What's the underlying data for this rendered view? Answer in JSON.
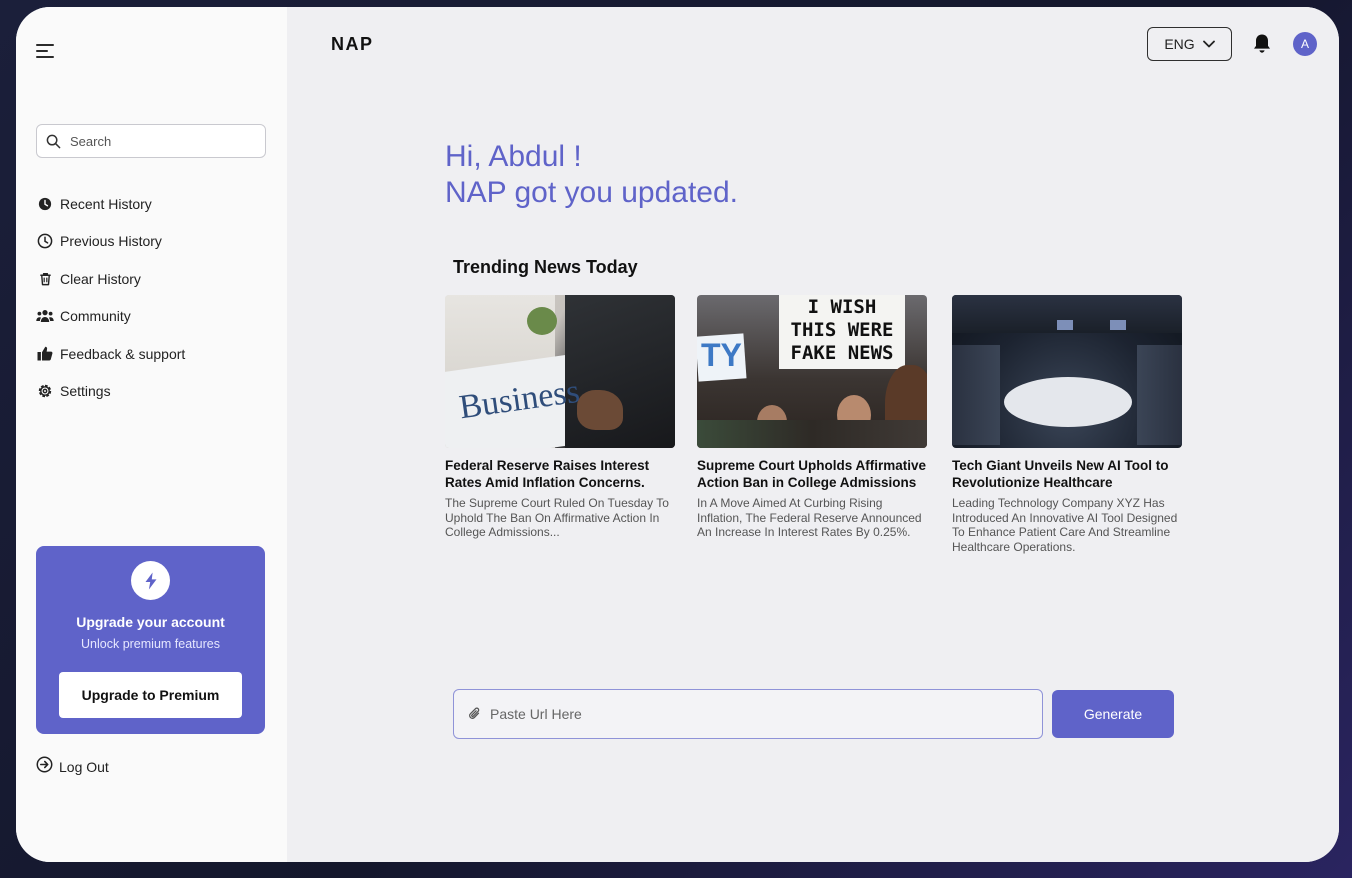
{
  "app": {
    "logo": "NAP"
  },
  "header": {
    "language": "ENG",
    "avatar_initial": "A"
  },
  "sidebar": {
    "search_placeholder": "Search",
    "items": [
      {
        "label": "Recent History",
        "icon": "clock-filled-icon"
      },
      {
        "label": "Previous History",
        "icon": "clock-outline-icon"
      },
      {
        "label": "Clear History",
        "icon": "trash-icon"
      },
      {
        "label": "Community",
        "icon": "users-icon"
      },
      {
        "label": "Feedback & support",
        "icon": "thumbs-up-icon"
      },
      {
        "label": "Settings",
        "icon": "gear-icon"
      }
    ],
    "upgrade": {
      "title": "Upgrade your account",
      "subtitle": "Unlock premium features",
      "button": "Upgrade to Premium"
    },
    "logout": "Log Out"
  },
  "main": {
    "greeting_line1": "Hi, Abdul !",
    "greeting_line2": "NAP got you updated.",
    "trending_title": "Trending News Today",
    "cards": [
      {
        "headline": "Federal Reserve Raises Interest Rates Amid Inflation Concerns.",
        "description": "The Supreme Court Ruled On Tuesday To Uphold The Ban On Affirmative Action In College Admissions...",
        "image_text": "Business"
      },
      {
        "headline": "Supreme Court Upholds Affirmative Action Ban in College Admissions",
        "description": "In A Move Aimed At Curbing Rising Inflation, The Federal Reserve Announced An Increase In Interest Rates By 0.25%.",
        "image_text": "I WISH THIS WERE FAKE NEWS",
        "image_text_left": "TY"
      },
      {
        "headline": "Tech Giant Unveils New AI Tool to Revolutionize Healthcare",
        "description": "Leading Technology Company XYZ Has Introduced An Innovative AI Tool Designed To Enhance Patient Care And Streamline Healthcare Operations."
      }
    ],
    "url_placeholder": "Paste Url Here",
    "generate_button": "Generate"
  },
  "colors": {
    "accent": "#5f63c9",
    "sidebar_bg": "#fafafa",
    "main_bg": "#efeff2"
  }
}
